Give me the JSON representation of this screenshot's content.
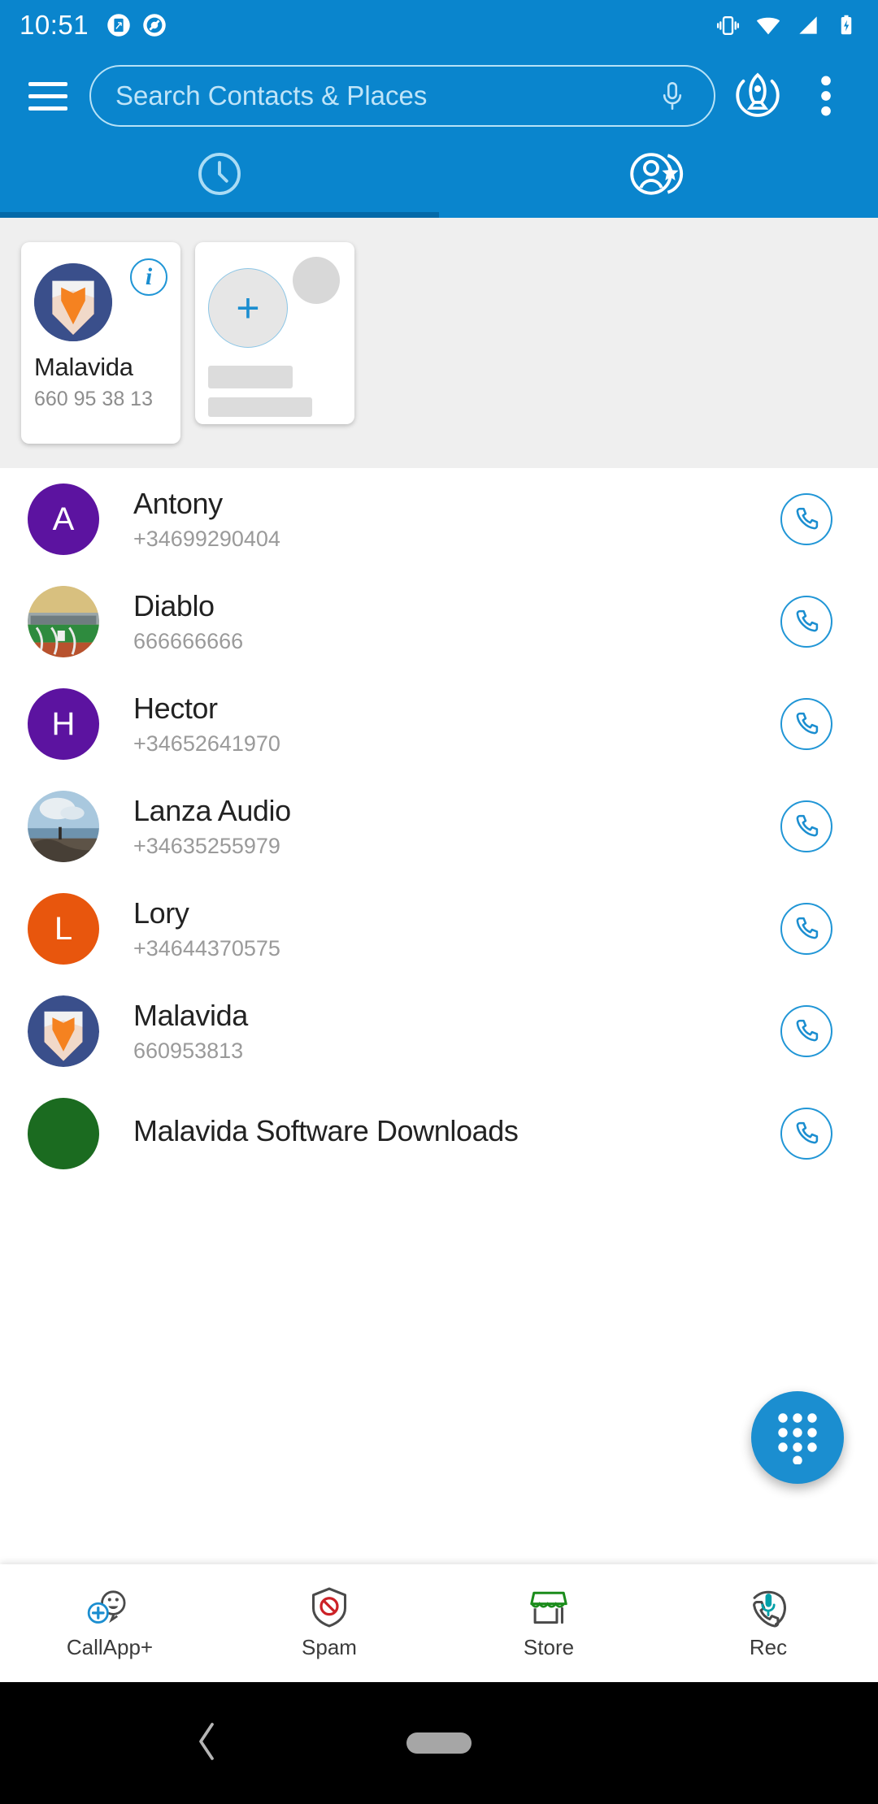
{
  "status_bar": {
    "time": "10:51",
    "left_icons": [
      "screenshot-icon",
      "screen-record-icon"
    ],
    "right_icons": [
      "vibrate-icon",
      "wifi-icon",
      "cellular-signal-icon",
      "battery-charging-icon"
    ],
    "background_color": "#0a85cd"
  },
  "app_bar": {
    "menu_icon": "hamburger-menu-icon",
    "search_placeholder": "Search Contacts & Places",
    "mic_icon": "microphone-icon",
    "rocket_icon": "rocket-icon",
    "overflow_icon": "overflow-menu-icon"
  },
  "tabs": [
    {
      "name": "recents-tab",
      "icon": "clock-icon",
      "active": true
    },
    {
      "name": "favorites-tab",
      "icon": "person-star-icon",
      "active": false
    }
  ],
  "favorites": {
    "cards": [
      {
        "type": "contact",
        "name": "Malavida",
        "phone": "660 95 38 13",
        "avatar": "malavida-logo",
        "badge_icon": "info-icon"
      },
      {
        "type": "add-placeholder",
        "add_icon": "plus-icon",
        "name": "",
        "phone": ""
      }
    ]
  },
  "contacts": [
    {
      "name": "Antony",
      "phone": "+34699290404",
      "avatar_type": "initial",
      "initial": "A",
      "color": "#5c13a0",
      "call_icon": "phone-icon"
    },
    {
      "name": "Diablo",
      "phone": "666666666",
      "avatar_type": "photo",
      "initial": "",
      "color": "#7b8a3c",
      "call_icon": "phone-icon"
    },
    {
      "name": "Hector",
      "phone": "+34652641970",
      "avatar_type": "initial",
      "initial": "H",
      "color": "#5c13a0",
      "call_icon": "phone-icon"
    },
    {
      "name": "Lanza Audio",
      "phone": "+34635255979",
      "avatar_type": "photo",
      "initial": "",
      "color": "#8fa8bd",
      "call_icon": "phone-icon"
    },
    {
      "name": "Lory",
      "phone": "+34644370575",
      "avatar_type": "initial",
      "initial": "L",
      "color": "#e8560d",
      "call_icon": "phone-icon"
    },
    {
      "name": "Malavida",
      "phone": "660953813",
      "avatar_type": "logo",
      "initial": "",
      "color": "#3a4f8b",
      "call_icon": "phone-icon"
    },
    {
      "name": "Malavida Software Downloads",
      "phone": "",
      "avatar_type": "initial",
      "initial": "",
      "color": "#1b6b20",
      "call_icon": "phone-icon"
    }
  ],
  "fab": {
    "name": "dialpad-fab",
    "icon": "dialpad-icon",
    "color": "#1b8ed0"
  },
  "bottom_nav": [
    {
      "label": "CallApp+",
      "icon": "callapp-plus-icon"
    },
    {
      "label": "Spam",
      "icon": "spam-shield-icon"
    },
    {
      "label": "Store",
      "icon": "store-icon"
    },
    {
      "label": "Rec",
      "icon": "record-call-icon"
    }
  ],
  "system_nav": {
    "back_icon": "back-chevron-icon",
    "home_icon": "home-pill-icon"
  }
}
